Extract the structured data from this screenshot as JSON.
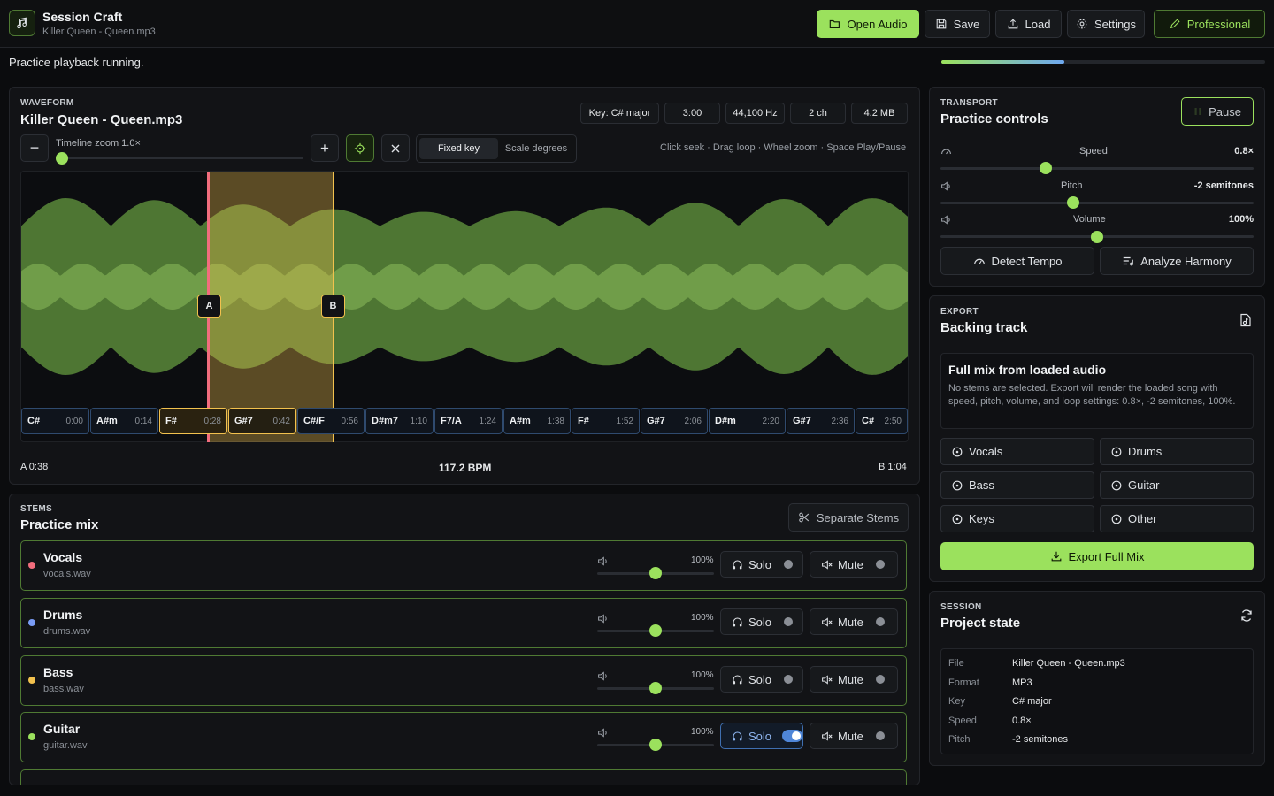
{
  "header": {
    "app_title": "Session Craft",
    "subtitle": "Killer Queen - Queen.mp3",
    "buttons": {
      "open_audio": "Open Audio",
      "save": "Save",
      "load": "Load",
      "settings": "Settings",
      "professional": "Professional"
    }
  },
  "status": {
    "message": "Practice playback running.",
    "progress": 0.38
  },
  "waveform": {
    "eyebrow": "WAVEFORM",
    "title": "Killer Queen - Queen.mp3",
    "meta": {
      "key": "Key: C# major",
      "duration": "3:00",
      "sample_rate": "44,100 Hz",
      "channels": "2 ch",
      "size": "4.2 MB"
    },
    "zoom_label": "Timeline zoom 1.0×",
    "zoom_level": 0.0,
    "seg": {
      "fixed_key": "Fixed key",
      "scale_degrees": "Scale degrees"
    },
    "hint": "Click seek · Drag loop · Wheel zoom · Space Play/Pause",
    "marker_a": "A",
    "marker_b": "B",
    "loop_start": "A 0:38",
    "loop_end": "B 1:04",
    "bpm": "117.2 BPM",
    "chords": [
      {
        "name": "C#",
        "time": "0:00"
      },
      {
        "name": "A#m",
        "time": "0:14"
      },
      {
        "name": "F#",
        "time": "0:28"
      },
      {
        "name": "G#7",
        "time": "0:42"
      },
      {
        "name": "C#/F",
        "time": "0:56"
      },
      {
        "name": "D#m7",
        "time": "1:10"
      },
      {
        "name": "F7/A",
        "time": "1:24"
      },
      {
        "name": "A#m",
        "time": "1:38"
      },
      {
        "name": "F#",
        "time": "1:52"
      },
      {
        "name": "G#7",
        "time": "2:06"
      },
      {
        "name": "D#m",
        "time": "2:20"
      },
      {
        "name": "G#7",
        "time": "2:36"
      },
      {
        "name": "C#",
        "time": "2:50"
      }
    ]
  },
  "stems": {
    "eyebrow": "STEMS",
    "title": "Practice mix",
    "separate_btn": "Separate Stems",
    "solo_label": "Solo",
    "mute_label": "Mute",
    "items": [
      {
        "name": "Vocals",
        "file": "vocals.wav",
        "volume": "100%",
        "color": "#f26d7d",
        "solo": false
      },
      {
        "name": "Drums",
        "file": "drums.wav",
        "volume": "100%",
        "color": "#7a9cf5",
        "solo": false
      },
      {
        "name": "Bass",
        "file": "bass.wav",
        "volume": "100%",
        "color": "#f2c14e",
        "solo": false
      },
      {
        "name": "Guitar",
        "file": "guitar.wav",
        "volume": "100%",
        "color": "#9be15d",
        "solo": true
      }
    ]
  },
  "transport": {
    "eyebrow": "TRANSPORT",
    "title": "Practice controls",
    "pause": "Pause",
    "speed_label": "Speed",
    "speed_value": "0.8×",
    "speed_level": 0.33,
    "pitch_label": "Pitch",
    "pitch_value": "-2 semitones",
    "pitch_level": 0.42,
    "volume_label": "Volume",
    "volume_value": "100%",
    "volume_level": 0.5,
    "detect_tempo": "Detect Tempo",
    "analyze_harmony": "Analyze Harmony"
  },
  "export": {
    "eyebrow": "EXPORT",
    "title": "Backing track",
    "box_title": "Full mix from loaded audio",
    "box_text": "No stems are selected. Export will render the loaded song with speed, pitch, volume, and loop settings: 0.8×, -2 semitones, 100%.",
    "stems": [
      "Vocals",
      "Drums",
      "Bass",
      "Guitar",
      "Keys",
      "Other"
    ],
    "export_btn": "Export Full Mix"
  },
  "session": {
    "eyebrow": "SESSION",
    "title": "Project state",
    "rows": [
      {
        "k": "File",
        "v": "Killer Queen - Queen.mp3"
      },
      {
        "k": "Format",
        "v": "MP3"
      },
      {
        "k": "Key",
        "v": "C# major"
      },
      {
        "k": "Speed",
        "v": "0.8×"
      },
      {
        "k": "Pitch",
        "v": "-2 semitones"
      }
    ]
  },
  "colors": {
    "accent": "#9be15d",
    "loop": "#f2c14e",
    "playhead": "#f26d7d",
    "chord_border": "#2f4a6e"
  }
}
